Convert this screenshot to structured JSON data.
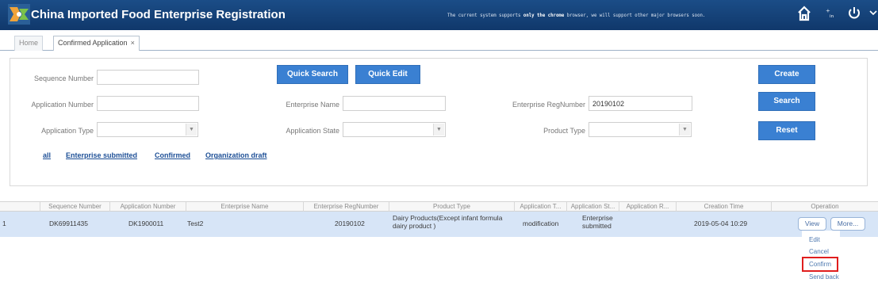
{
  "header": {
    "title": "China Imported Food Enterprise Registration",
    "notice_pre": "The current system supports",
    "notice_bold": "only the chrome",
    "notice_post": "browser, we will support other major browsers soon.",
    "icons": [
      "home-icon",
      "language-icon",
      "power-icon",
      "chevron-down-icon"
    ]
  },
  "tabs": [
    {
      "label": "Home"
    },
    {
      "label": "Confirmed Application",
      "close": "×"
    }
  ],
  "search": {
    "sequence_label": "Sequence Number",
    "sequence_value": "",
    "application_number_label": "Application Number",
    "application_number_value": "",
    "enterprise_name_label": "Enterprise Name",
    "enterprise_name_value": "",
    "enterprise_regnumber_label": "Enterprise RegNumber",
    "enterprise_regnumber_value": "20190102",
    "application_type_label": "Application Type",
    "application_type_value": "",
    "application_state_label": "Application State",
    "application_state_value": "",
    "product_type_label": "Product Type",
    "product_type_value": "",
    "buttons": {
      "quick_search": "Quick Search",
      "quick_edit": "Quick Edit",
      "create": "Create",
      "search": "Search",
      "reset": "Reset"
    },
    "quick_links": [
      "all",
      "Enterprise submitted",
      "Confirmed",
      "Organization draft"
    ]
  },
  "table": {
    "columns": [
      "Sequence Number",
      "Application Number",
      "Enterprise Name",
      "Enterprise RegNumber",
      "Product Type",
      "Application T...",
      "Application St...",
      "Application R...",
      "Creation Time",
      "Operation"
    ],
    "rows": [
      {
        "index": "1",
        "sequence_number": "DK69911435",
        "application_number": "DK1900011",
        "enterprise_name": "Test2",
        "regnumber": "20190102",
        "product_type": "Dairy Products(Except infant formula dairy product )",
        "application_type": "modification",
        "application_state": "Enterprise submitted",
        "application_r": "",
        "creation_time": "2019-05-04 10:29",
        "view_label": "View",
        "more_label": "More..."
      }
    ]
  },
  "more_menu": {
    "items": [
      "Edit",
      "Cancel",
      "Confirm",
      "Send back"
    ],
    "highlighted": "Confirm"
  },
  "colors": {
    "header": "#16447a",
    "button": "#3a80d2",
    "row_selected": "#d7e5f7",
    "highlight_box": "#e01e1e"
  }
}
